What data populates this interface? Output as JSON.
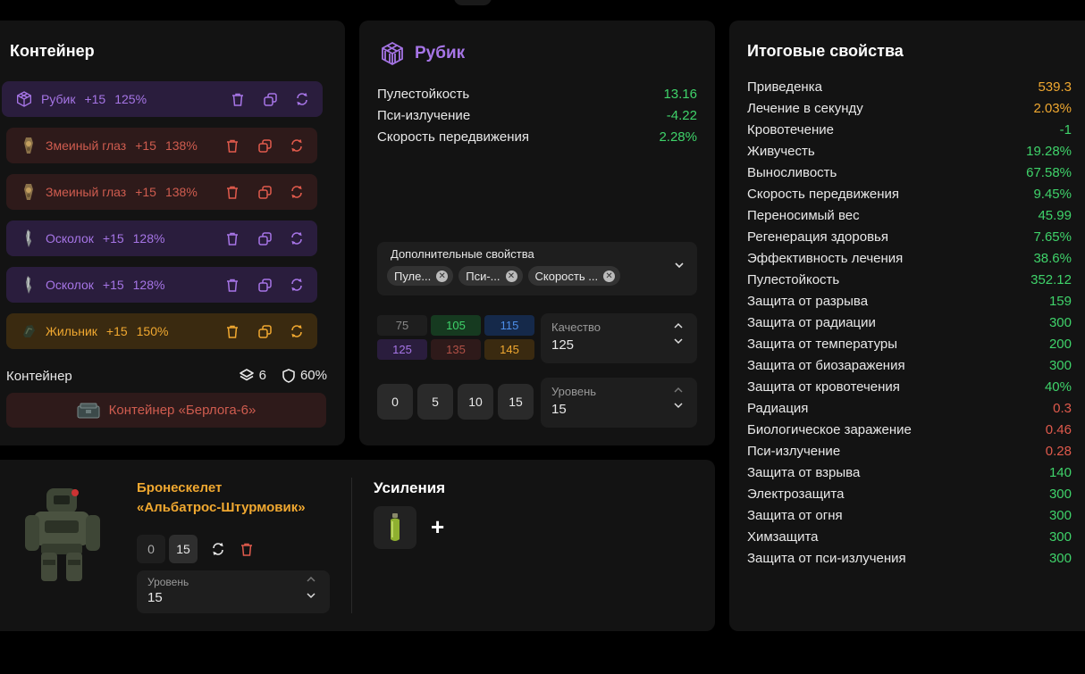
{
  "container": {
    "title": "Контейнер",
    "artifacts": [
      {
        "name": "Рубик",
        "level": "+15",
        "quality": "125%",
        "color": "purple",
        "icon": "cube-artifact-icon"
      },
      {
        "name": "Змеиный глаз",
        "level": "+15",
        "quality": "138%",
        "color": "red",
        "icon": "snake-eye-artifact-icon"
      },
      {
        "name": "Змеиный глаз",
        "level": "+15",
        "quality": "138%",
        "color": "red",
        "icon": "snake-eye-artifact-icon"
      },
      {
        "name": "Осколок",
        "level": "+15",
        "quality": "128%",
        "color": "purple",
        "icon": "shard-artifact-icon"
      },
      {
        "name": "Осколок",
        "level": "+15",
        "quality": "128%",
        "color": "purple",
        "icon": "shard-artifact-icon"
      },
      {
        "name": "Жильник",
        "level": "+15",
        "quality": "150%",
        "color": "yellow",
        "icon": "vein-artifact-icon"
      }
    ],
    "footer_label": "Контейнер",
    "slots": "6",
    "protection": "60%",
    "container_item": "Контейнер «Берлога-6»"
  },
  "detail": {
    "title": "Рубик",
    "props": [
      {
        "name": "Пулестойкость",
        "value": "13.16",
        "color": "green"
      },
      {
        "name": "Пси-излучение",
        "value": "-4.22",
        "color": "green"
      },
      {
        "name": "Скорость передвижения",
        "value": "2.28%",
        "color": "green"
      }
    ],
    "extra_label": "Дополнительные свойства",
    "chips": [
      "Пуле...",
      "Пси-...",
      "Скорость ..."
    ],
    "quality_options": [
      "75",
      "105",
      "115",
      "125",
      "135",
      "145"
    ],
    "quality_label": "Качество",
    "quality_value": "125",
    "level_buttons": [
      "0",
      "5",
      "10",
      "15"
    ],
    "level_label": "Уровень",
    "level_value": "15"
  },
  "armor": {
    "name_line1": "Бронескелет",
    "name_line2": "«Альбатрос-Штурмовик»",
    "level_buttons": [
      "0",
      "15"
    ],
    "level_label": "Уровень",
    "level_value": "15",
    "boosts_title": "Усиления",
    "add_label": "+"
  },
  "totals": {
    "title": "Итоговые свойства",
    "props": [
      {
        "name": "Приведенка",
        "value": "539.3",
        "color": "orange"
      },
      {
        "name": "Лечение в секунду",
        "value": "2.03%",
        "color": "orange"
      },
      {
        "name": "Кровотечение",
        "value": "-1",
        "color": "green"
      },
      {
        "name": "Живучесть",
        "value": "19.28%",
        "color": "green"
      },
      {
        "name": "Выносливость",
        "value": "67.58%",
        "color": "green"
      },
      {
        "name": "Скорость передвижения",
        "value": "9.45%",
        "color": "green"
      },
      {
        "name": "Переносимый вес",
        "value": "45.99",
        "color": "green"
      },
      {
        "name": "Регенерация здоровья",
        "value": "7.65%",
        "color": "green"
      },
      {
        "name": "Эффективность лечения",
        "value": "38.6%",
        "color": "green"
      },
      {
        "name": "Пулестойкость",
        "value": "352.12",
        "color": "green"
      },
      {
        "name": "Защита от разрыва",
        "value": "159",
        "color": "green"
      },
      {
        "name": "Защита от радиации",
        "value": "300",
        "color": "green"
      },
      {
        "name": "Защита от температуры",
        "value": "200",
        "color": "green"
      },
      {
        "name": "Защита от биозаражения",
        "value": "300",
        "color": "green"
      },
      {
        "name": "Защита от кровотечения",
        "value": "40%",
        "color": "green"
      },
      {
        "name": "Радиация",
        "value": "0.3",
        "color": "red"
      },
      {
        "name": "Биологическое заражение",
        "value": "0.46",
        "color": "red"
      },
      {
        "name": "Пси-излучение",
        "value": "0.28",
        "color": "red"
      },
      {
        "name": "Защита от взрыва",
        "value": "140",
        "color": "green"
      },
      {
        "name": "Электрозащита",
        "value": "300",
        "color": "green"
      },
      {
        "name": "Защита от огня",
        "value": "300",
        "color": "green"
      },
      {
        "name": "Химзащита",
        "value": "300",
        "color": "green"
      },
      {
        "name": "Защита от пси-излучения",
        "value": "300",
        "color": "green"
      }
    ]
  },
  "colors": {
    "green": "#3fd36a",
    "orange": "#f0a830",
    "red": "#e05a4c",
    "purple": "#a675e6"
  }
}
